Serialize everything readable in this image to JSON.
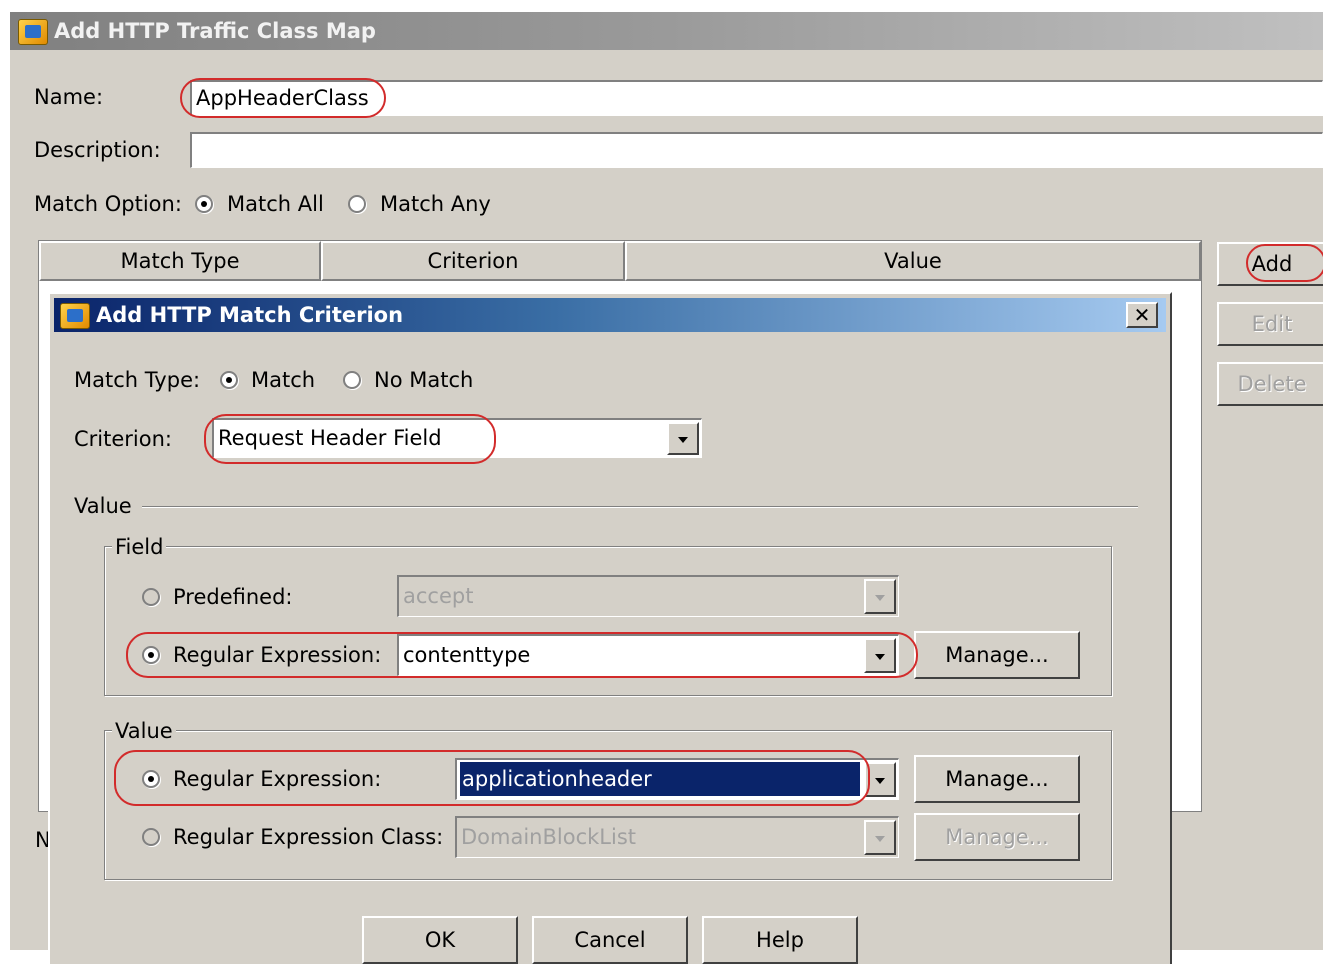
{
  "outer_window": {
    "title": "Add HTTP Traffic Class Map",
    "name_label": "Name:",
    "name_value": "AppHeaderClass",
    "description_label": "Description:",
    "description_value": "",
    "match_option_label": "Match Option:",
    "match_all_label": "Match All",
    "match_any_label": "Match Any",
    "match_option_selected": "Match All",
    "table_headers": [
      "Match Type",
      "Criterion",
      "Value"
    ],
    "buttons": {
      "add": "Add",
      "edit": "Edit",
      "delete": "Delete"
    },
    "partial_label": "N"
  },
  "dialog": {
    "title": "Add HTTP Match Criterion",
    "close_glyph": "✕",
    "match_type_label": "Match Type:",
    "match_label": "Match",
    "no_match_label": "No Match",
    "match_type_selected": "Match",
    "criterion_label": "Criterion:",
    "criterion_value": "Request Header Field",
    "value_section_label": "Value",
    "field_group": {
      "title": "Field",
      "predefined_label": "Predefined:",
      "predefined_value": "accept",
      "regex_label": "Regular Expression:",
      "regex_value": "contenttype",
      "manage_label": "Manage...",
      "selected": "Regular Expression"
    },
    "value_group": {
      "title": "Value",
      "regex_label": "Regular Expression:",
      "regex_value": "applicationheader",
      "regex_manage_label": "Manage...",
      "regex_class_label": "Regular Expression Class:",
      "regex_class_value": "DomainBlockList",
      "regex_class_manage_label": "Manage...",
      "selected": "Regular Expression"
    },
    "buttons": {
      "ok": "OK",
      "cancel": "Cancel",
      "help": "Help"
    }
  },
  "colors": {
    "annotation": "#d22b2b",
    "selection": "#0a246a",
    "dialog_face": "#d4d0c8"
  }
}
